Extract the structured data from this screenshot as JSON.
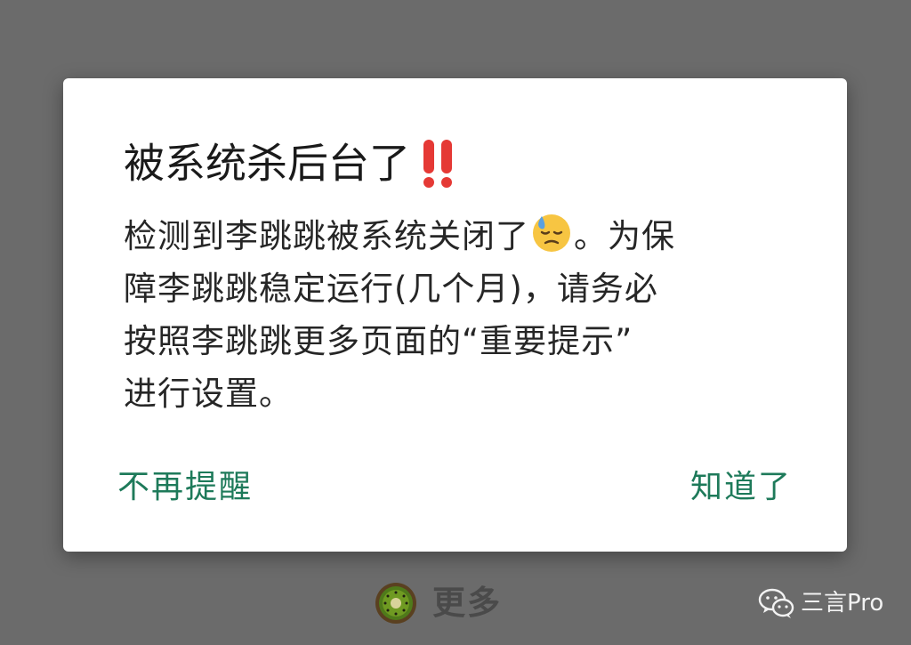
{
  "dialog": {
    "title": "被系统杀后台了",
    "message": {
      "line1_before_emoji": "检测到李跳跳被系统关闭了",
      "line1_after_emoji": "。为保",
      "line2": "障李跳跳稳定运行(几个月)，请务必",
      "line3": "按照李跳跳更多页面的“重要提示”",
      "line4": "进行设置。"
    },
    "buttons": {
      "dont_remind": "不再提醒",
      "got_it": "知道了"
    }
  },
  "background": {
    "more_label": "更多"
  },
  "watermark": {
    "label": "三言Pro"
  },
  "colors": {
    "accent": "#1e7a5a",
    "overlay": "#6b6b6b",
    "alert_red": "#e53935"
  },
  "icons": {
    "title_icon": "double-exclamation-icon",
    "message_icon": "downcast-face-with-sweat-icon",
    "background_icon": "kiwi-icon",
    "watermark_icon": "wechat-icon"
  }
}
